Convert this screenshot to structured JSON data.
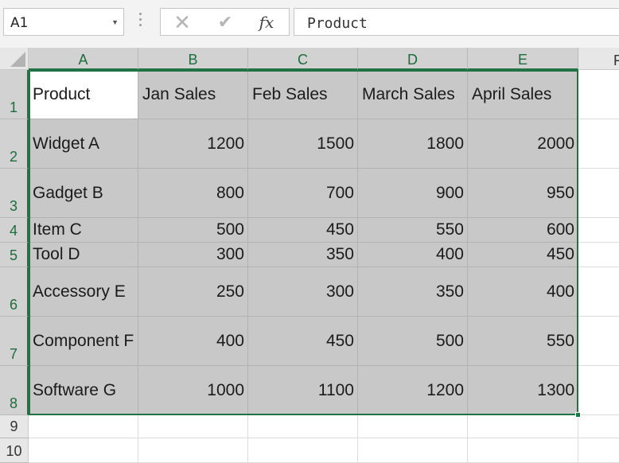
{
  "name_box": {
    "value": "A1",
    "arrow_icon": "chevron-down-icon"
  },
  "formula_bar": {
    "cancel_icon": "✕",
    "enter_icon": "✔",
    "fx_label": "fx",
    "content": "Product"
  },
  "columns": [
    "A",
    "B",
    "C",
    "D",
    "E"
  ],
  "peek_column": "F",
  "rows": [
    "1",
    "2",
    "3",
    "4",
    "5",
    "6",
    "7",
    "8",
    "9",
    "10"
  ],
  "headers": [
    "Product",
    "Jan Sales",
    "Feb Sales",
    "March Sales",
    "April Sales"
  ],
  "data": [
    [
      "Widget A",
      "1200",
      "1500",
      "1800",
      "2000"
    ],
    [
      "Gadget B",
      "800",
      "700",
      "900",
      "950"
    ],
    [
      "Item C",
      "500",
      "450",
      "550",
      "600"
    ],
    [
      "Tool D",
      "300",
      "350",
      "400",
      "450"
    ],
    [
      "Accessory E",
      "250",
      "300",
      "350",
      "400"
    ],
    [
      "Component F",
      "400",
      "450",
      "500",
      "550"
    ],
    [
      "Software G",
      "1000",
      "1100",
      "1200",
      "1300"
    ]
  ],
  "colors": {
    "selection": "#217346",
    "selected_fill": "#c8c8c8"
  }
}
